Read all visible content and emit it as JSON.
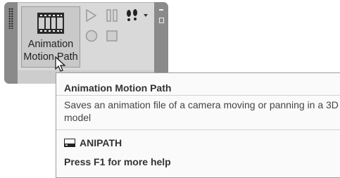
{
  "ribbon": {
    "big_button_label": "Animation Motion Path",
    "big_button_icon": "film-strip-icon",
    "small_buttons": [
      {
        "name": "play",
        "icon": "play-icon"
      },
      {
        "name": "pause",
        "icon": "pause-icon"
      },
      {
        "name": "walk-fly",
        "icon": "footprints-icon"
      },
      {
        "name": "dropdown",
        "icon": "chevron-down-icon"
      },
      {
        "name": "record",
        "icon": "record-icon"
      },
      {
        "name": "stop",
        "icon": "stop-icon"
      }
    ]
  },
  "tooltip": {
    "title": "Animation Motion Path",
    "description": "Saves an animation file of a camera moving or panning in a 3D model",
    "command_icon": "command-icon",
    "command": "ANIPATH",
    "help": "Press F1 for more help"
  },
  "colors": {
    "panel_bg": "#d9d9d9",
    "grip": "#8a8a8a",
    "tooltip_bg": "#fafafa"
  }
}
